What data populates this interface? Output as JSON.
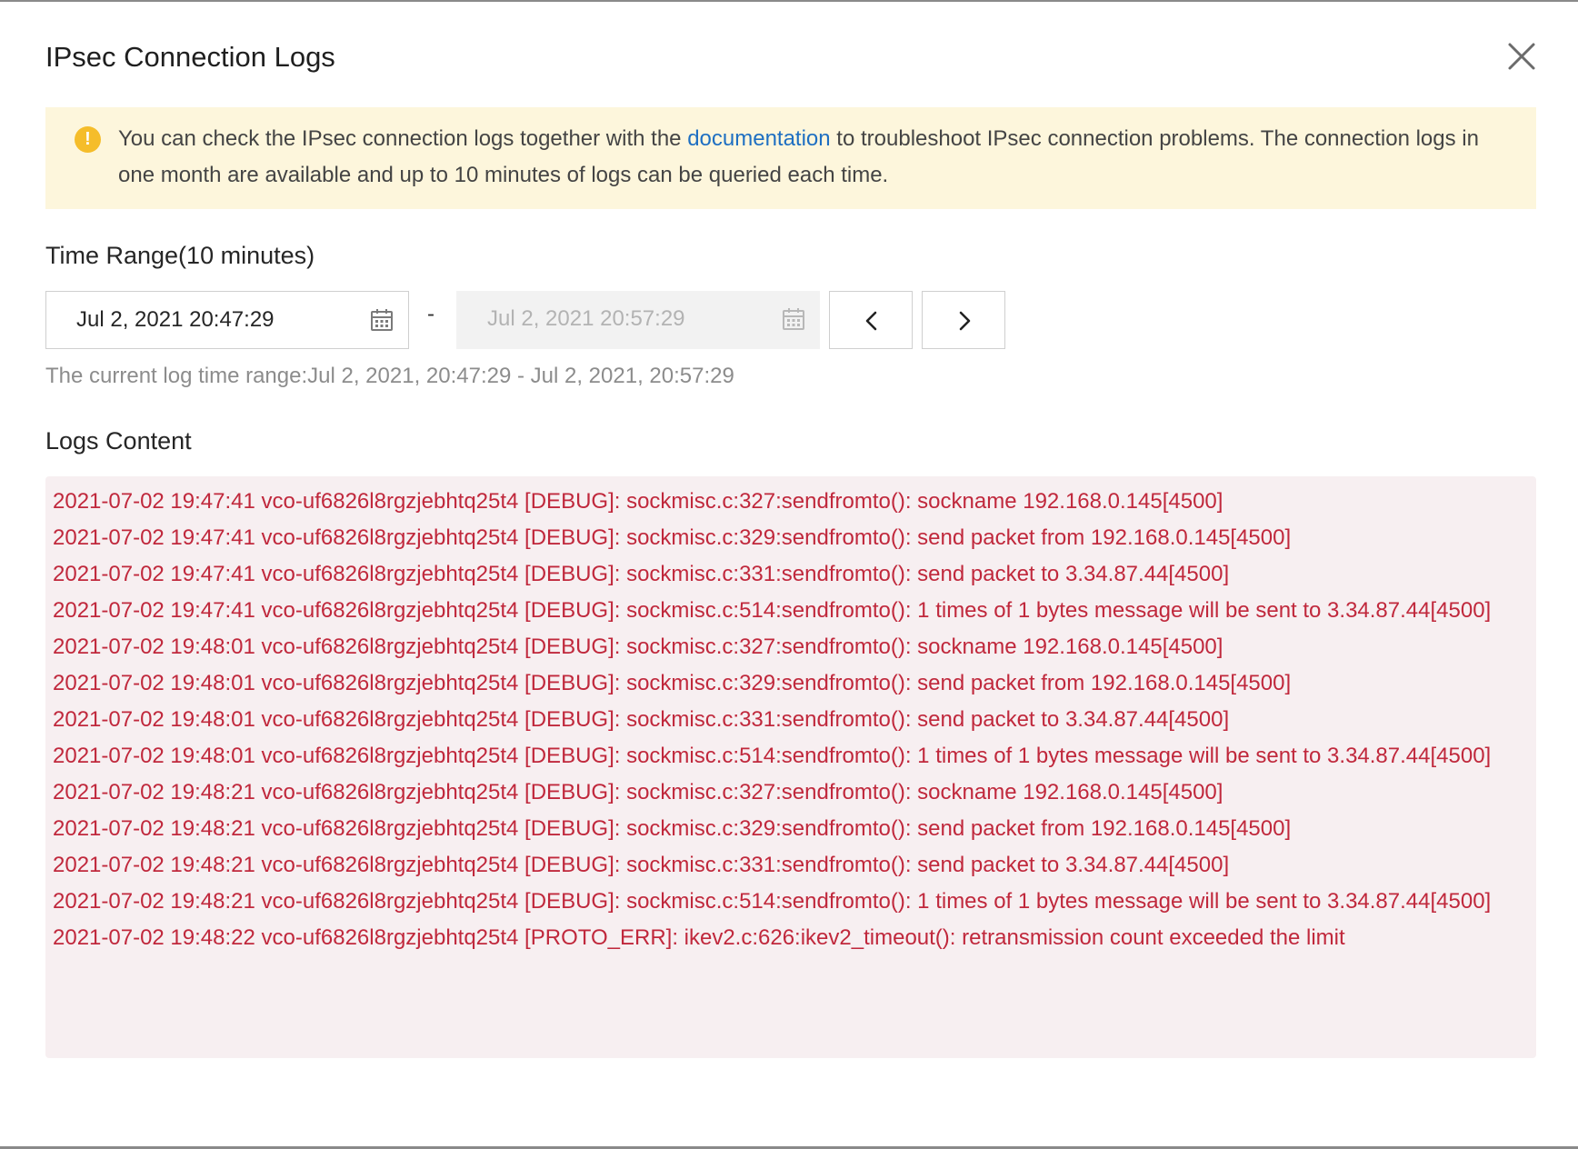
{
  "dialog": {
    "title": "IPsec Connection Logs"
  },
  "notice": {
    "text_before": "You can check the IPsec connection logs together with the ",
    "link_label": "documentation",
    "text_after": " to troubleshoot IPsec connection problems. The connection logs in one month are available and up to 10 minutes of logs can be queried each time.",
    "icon": "exclamation-circle-icon",
    "icon_color": "#f5bd2a",
    "background_color": "#fdf6dc"
  },
  "time_range": {
    "label": "Time Range(10 minutes)",
    "start_value": "Jul 2, 2021 20:47:29",
    "end_value": "Jul 2, 2021 20:57:29",
    "separator": "-",
    "prev_icon": "chevron-left-icon",
    "next_icon": "chevron-right-icon",
    "current_range_text": "The current log time range:Jul 2, 2021, 20:47:29 - Jul 2, 2021, 20:57:29"
  },
  "logs": {
    "label": "Logs Content",
    "text_color": "#c0283c",
    "background_color": "#f7eff1",
    "lines": [
      "2021-07-02 19:47:41 vco-uf6826l8rgzjebhtq25t4 [DEBUG]: sockmisc.c:327:sendfromto(): sockname 192.168.0.145[4500]",
      "2021-07-02 19:47:41 vco-uf6826l8rgzjebhtq25t4 [DEBUG]: sockmisc.c:329:sendfromto(): send packet from 192.168.0.145[4500]",
      "2021-07-02 19:47:41 vco-uf6826l8rgzjebhtq25t4 [DEBUG]: sockmisc.c:331:sendfromto(): send packet to 3.34.87.44[4500]",
      "2021-07-02 19:47:41 vco-uf6826l8rgzjebhtq25t4 [DEBUG]: sockmisc.c:514:sendfromto(): 1 times of 1 bytes message will be sent to 3.34.87.44[4500]",
      "2021-07-02 19:48:01 vco-uf6826l8rgzjebhtq25t4 [DEBUG]: sockmisc.c:327:sendfromto(): sockname 192.168.0.145[4500]",
      "2021-07-02 19:48:01 vco-uf6826l8rgzjebhtq25t4 [DEBUG]: sockmisc.c:329:sendfromto(): send packet from 192.168.0.145[4500]",
      "2021-07-02 19:48:01 vco-uf6826l8rgzjebhtq25t4 [DEBUG]: sockmisc.c:331:sendfromto(): send packet to 3.34.87.44[4500]",
      "2021-07-02 19:48:01 vco-uf6826l8rgzjebhtq25t4 [DEBUG]: sockmisc.c:514:sendfromto(): 1 times of 1 bytes message will be sent to 3.34.87.44[4500]",
      "2021-07-02 19:48:21 vco-uf6826l8rgzjebhtq25t4 [DEBUG]: sockmisc.c:327:sendfromto(): sockname 192.168.0.145[4500]",
      "2021-07-02 19:48:21 vco-uf6826l8rgzjebhtq25t4 [DEBUG]: sockmisc.c:329:sendfromto(): send packet from 192.168.0.145[4500]",
      "2021-07-02 19:48:21 vco-uf6826l8rgzjebhtq25t4 [DEBUG]: sockmisc.c:331:sendfromto(): send packet to 3.34.87.44[4500]",
      "2021-07-02 19:48:21 vco-uf6826l8rgzjebhtq25t4 [DEBUG]: sockmisc.c:514:sendfromto(): 1 times of 1 bytes message will be sent to 3.34.87.44[4500]",
      "2021-07-02 19:48:22 vco-uf6826l8rgzjebhtq25t4 [PROTO_ERR]: ikev2.c:626:ikev2_timeout(): retransmission count exceeded the limit"
    ]
  },
  "close_icon": "close-icon"
}
